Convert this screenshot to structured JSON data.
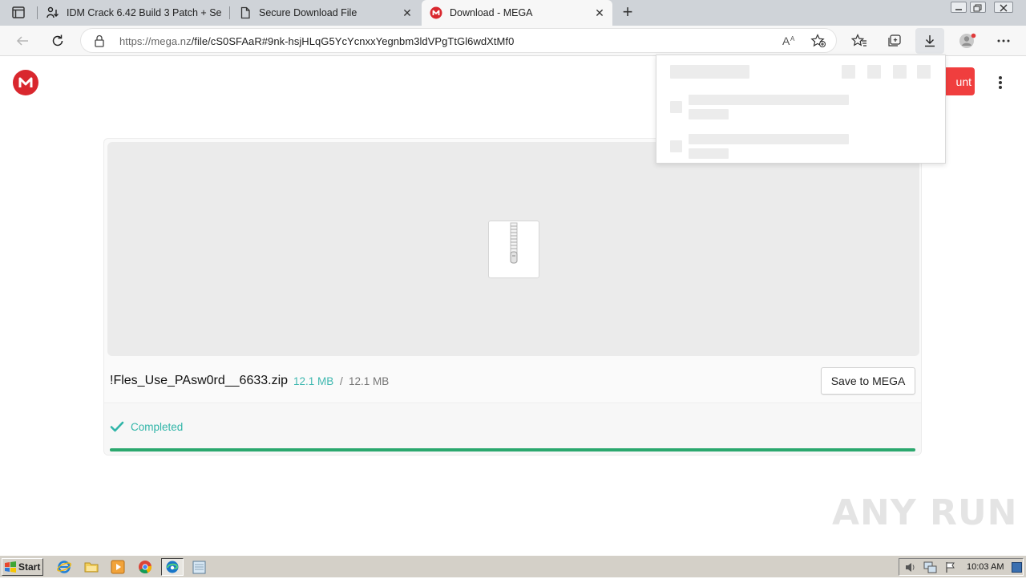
{
  "browser": {
    "tabs": [
      {
        "title": "IDM Crack 6.42 Build 3 Patch + Se",
        "icon": "download-person-icon"
      },
      {
        "title": "Secure Download File",
        "icon": "page-icon"
      },
      {
        "title": "Download - MEGA",
        "icon": "mega-favicon",
        "active": true
      }
    ],
    "url_host": "https://mega.nz",
    "url_path": "/file/cS0SFAaR#9nk-hsjHLqG5YcYcnxxYegnbm3ldVPgTtGl6wdXtMf0"
  },
  "page": {
    "logo_letter": "M",
    "create_account_partial": "unt",
    "file_name": "!Fles_Use_PAsw0rd__6633.zip",
    "size_done": "12.1 MB",
    "size_separator": "/",
    "size_total": "12.1 MB",
    "save_button": "Save to MEGA",
    "status": "Completed",
    "progress": 1.0,
    "accent_color": "#d9272e",
    "progress_color": "#2ba86e"
  },
  "watermark": "ANY RUN",
  "taskbar": {
    "start_label": "Start",
    "clock": "10:03 AM"
  }
}
